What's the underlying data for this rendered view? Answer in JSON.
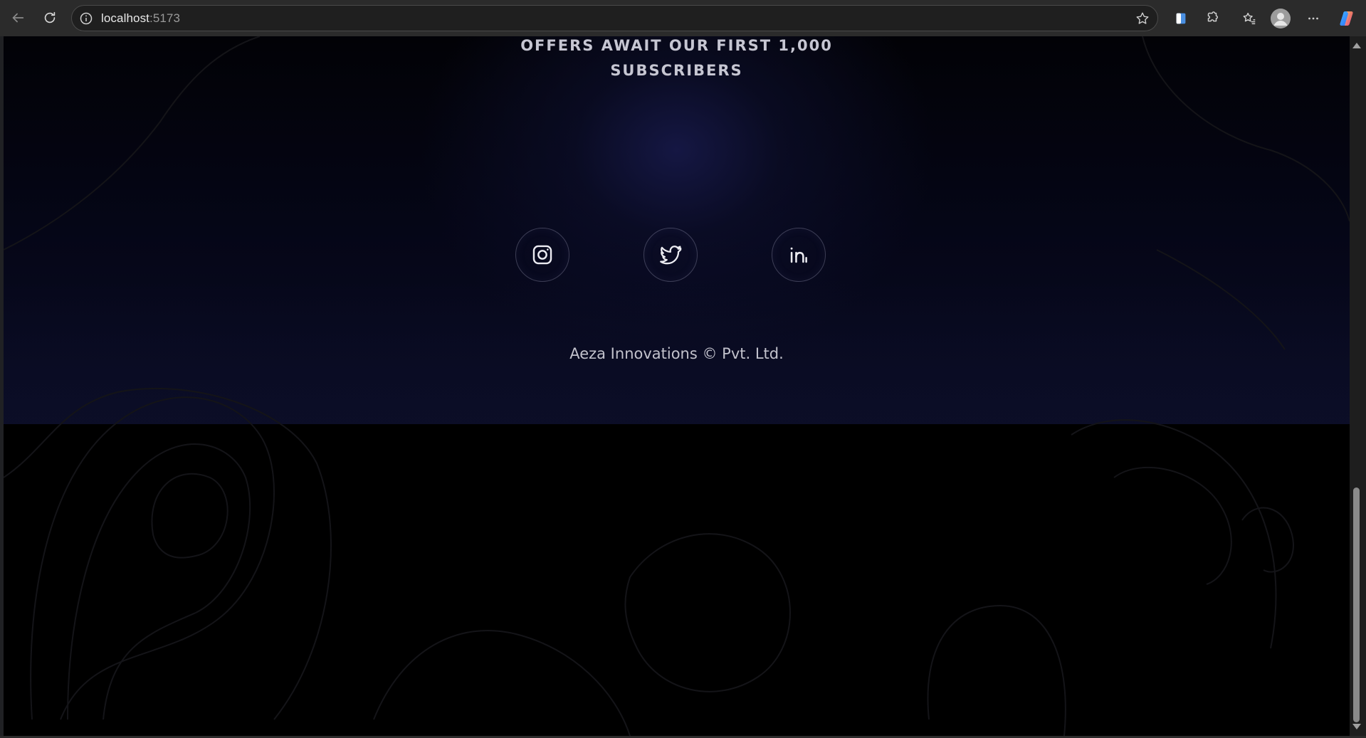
{
  "browser": {
    "url_host": "localhost",
    "url_port": ":5173",
    "icons": {
      "back": "back-arrow-icon",
      "reload": "reload-icon",
      "site_info": "info-icon",
      "favorite": "star-icon",
      "extensions": "puzzle-icon",
      "favorites": "favorites-icon",
      "profile": "avatar-icon",
      "more": "more-icon",
      "copilot": "copilot-icon"
    }
  },
  "page": {
    "headline_line1": "OFFERS AWAIT OUR FIRST 1,000",
    "headline_line2": "SUBSCRIBERS",
    "socials": [
      {
        "name": "instagram",
        "icon": "instagram-icon"
      },
      {
        "name": "twitter",
        "icon": "twitter-icon"
      },
      {
        "name": "linkedin",
        "icon": "linkedin-icon"
      }
    ],
    "copyright": "Aeza Innovations © Pvt. Ltd.",
    "colors": {
      "background": "#000000",
      "glow": "#161846",
      "text": "#c6c6d2"
    }
  }
}
